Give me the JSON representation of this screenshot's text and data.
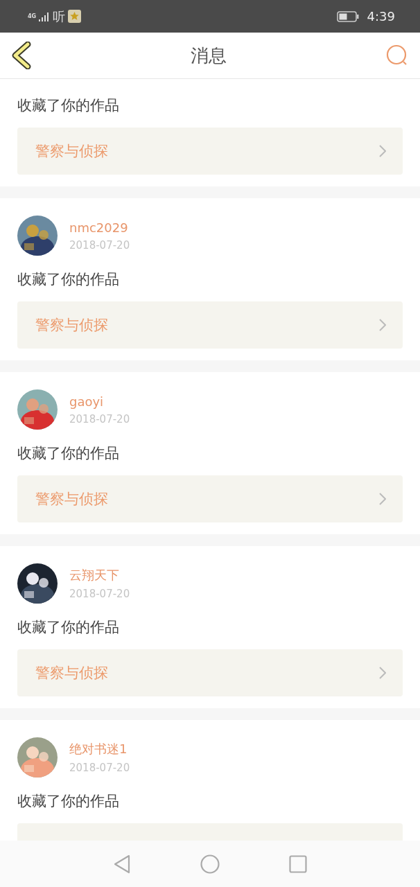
{
  "status_bar": {
    "network": "4G",
    "app_glyph": "听",
    "time": "4:39"
  },
  "header": {
    "title": "消息"
  },
  "messages": [
    {
      "kind": "partial",
      "action": "收藏了你的作品",
      "book": "警察与侦探"
    },
    {
      "kind": "full",
      "user": "nmc2029",
      "date": "2018-07-20",
      "action": "收藏了你的作品",
      "book": "警察与侦探"
    },
    {
      "kind": "full",
      "user": "gaoyi",
      "date": "2018-07-20",
      "action": "收藏了你的作品",
      "book": "警察与侦探"
    },
    {
      "kind": "full",
      "user": "云翔天下",
      "date": "2018-07-20",
      "action": "收藏了你的作品",
      "book": "警察与侦探"
    },
    {
      "kind": "full",
      "user": "绝对书迷1",
      "date": "2018-07-20",
      "action": "收藏了你的作品"
    }
  ]
}
